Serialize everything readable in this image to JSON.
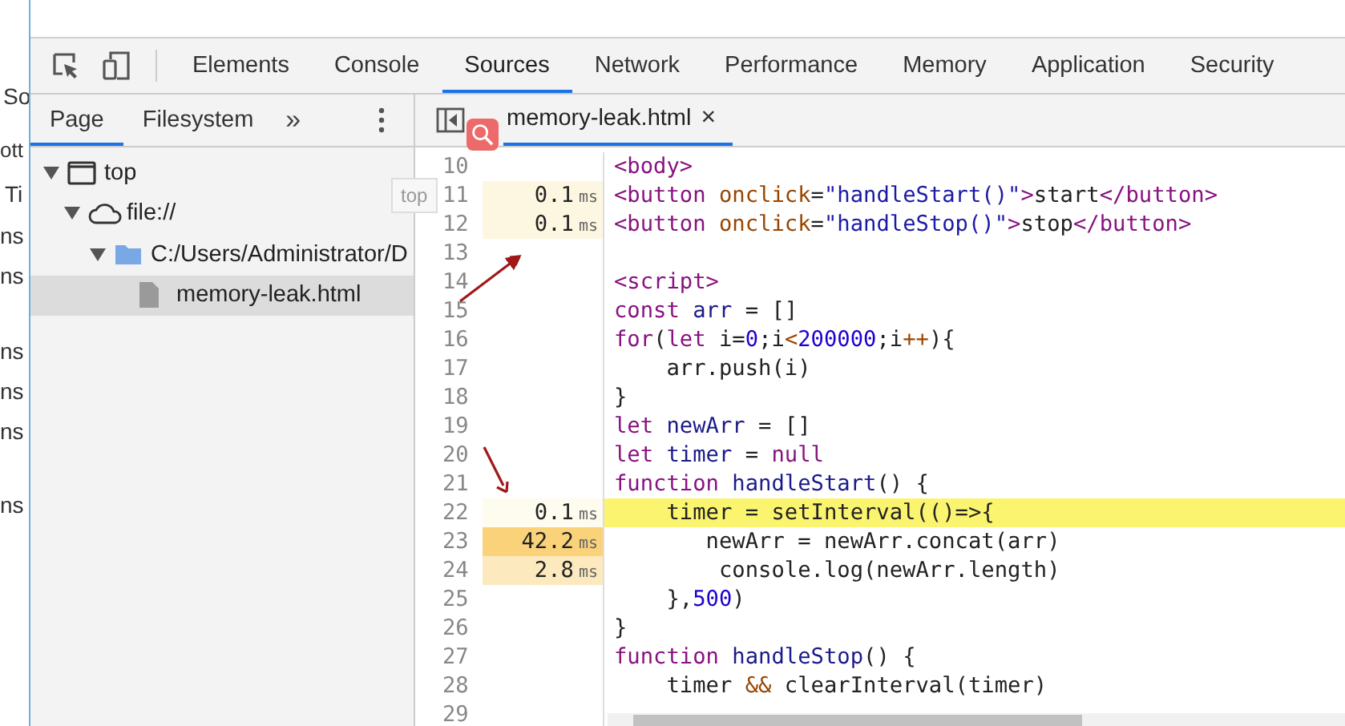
{
  "background_window": {
    "fragments": [
      "So",
      "ott",
      "Ti",
      "ns",
      "ns",
      "ns",
      "ns",
      "ns",
      "ns"
    ]
  },
  "toolbar": {
    "tabs": [
      {
        "label": "Elements",
        "selected": false
      },
      {
        "label": "Console",
        "selected": false
      },
      {
        "label": "Sources",
        "selected": true
      },
      {
        "label": "Network",
        "selected": false
      },
      {
        "label": "Performance",
        "selected": false
      },
      {
        "label": "Memory",
        "selected": false
      },
      {
        "label": "Application",
        "selected": false
      },
      {
        "label": "Security",
        "selected": false
      }
    ]
  },
  "navigator": {
    "tabs": [
      {
        "label": "Page",
        "selected": true
      },
      {
        "label": "Filesystem",
        "selected": false
      }
    ],
    "more": "»",
    "tree": [
      {
        "label": "top",
        "kind": "frame",
        "expanded": true,
        "selected": false,
        "children": [
          {
            "label": "file://",
            "kind": "origin",
            "expanded": true,
            "selected": false,
            "children": [
              {
                "label": "C:/Users/Administrator/D",
                "kind": "folder",
                "expanded": true,
                "selected": false,
                "children": [
                  {
                    "label": "memory-leak.html",
                    "kind": "file",
                    "expanded": false,
                    "selected": true
                  }
                ]
              }
            ]
          }
        ]
      }
    ]
  },
  "editor": {
    "tabs": [
      {
        "label": "memory-leak.html",
        "selected": true,
        "close": "×"
      }
    ],
    "lines": [
      {
        "number": "10",
        "current": false,
        "tokens": [
          {
            "kind": "tag",
            "text": "<body>"
          }
        ]
      },
      {
        "number": "11",
        "current": false,
        "time": "0.1",
        "unit": "ms",
        "color": "#fdf7e2",
        "tokens": [
          {
            "kind": "tag",
            "text": "<button "
          },
          {
            "kind": "attr",
            "text": "onclick"
          },
          {
            "kind": "plain",
            "text": "="
          },
          {
            "kind": "string",
            "text": "\"handleStart()\""
          },
          {
            "kind": "tag",
            "text": ">"
          },
          {
            "kind": "plain",
            "text": "start"
          },
          {
            "kind": "tag",
            "text": "</button>"
          }
        ]
      },
      {
        "number": "12",
        "current": false,
        "time": "0.1",
        "unit": "ms",
        "color": "#fdf7e2",
        "tokens": [
          {
            "kind": "tag",
            "text": "<button "
          },
          {
            "kind": "attr",
            "text": "onclick"
          },
          {
            "kind": "plain",
            "text": "="
          },
          {
            "kind": "string",
            "text": "\"handleStop()\""
          },
          {
            "kind": "tag",
            "text": ">"
          },
          {
            "kind": "plain",
            "text": "stop"
          },
          {
            "kind": "tag",
            "text": "</button>"
          }
        ]
      },
      {
        "number": "13",
        "current": false
      },
      {
        "number": "14",
        "current": false,
        "tokens": [
          {
            "kind": "tag",
            "text": "<script>"
          }
        ]
      },
      {
        "number": "15",
        "current": false,
        "tokens": [
          {
            "kind": "keyword",
            "text": "const"
          },
          {
            "kind": "def",
            "text": " arr"
          },
          {
            "kind": "plain",
            "text": " = []"
          }
        ]
      },
      {
        "number": "16",
        "current": false,
        "tokens": [
          {
            "kind": "keyword",
            "text": "for"
          },
          {
            "kind": "plain",
            "text": "("
          },
          {
            "kind": "keyword",
            "text": "let"
          },
          {
            "kind": "plain",
            "text": " i="
          },
          {
            "kind": "number",
            "text": "0"
          },
          {
            "kind": "plain",
            "text": ";i"
          },
          {
            "kind": "operator",
            "text": "<"
          },
          {
            "kind": "number",
            "text": "200000"
          },
          {
            "kind": "plain",
            "text": ";i"
          },
          {
            "kind": "operator",
            "text": "++"
          },
          {
            "kind": "plain",
            "text": "){"
          }
        ]
      },
      {
        "number": "17",
        "current": false,
        "tokens": [
          {
            "kind": "plain",
            "text": "    arr.push(i)"
          }
        ]
      },
      {
        "number": "18",
        "current": false,
        "tokens": [
          {
            "kind": "plain",
            "text": "}"
          }
        ]
      },
      {
        "number": "19",
        "current": false,
        "tokens": [
          {
            "kind": "keyword",
            "text": "let"
          },
          {
            "kind": "def",
            "text": " newArr"
          },
          {
            "kind": "plain",
            "text": " = []"
          }
        ]
      },
      {
        "number": "20",
        "current": false,
        "tokens": [
          {
            "kind": "keyword",
            "text": "let"
          },
          {
            "kind": "def",
            "text": " timer"
          },
          {
            "kind": "plain",
            "text": " = "
          },
          {
            "kind": "keyword",
            "text": "null"
          }
        ]
      },
      {
        "number": "21",
        "current": false,
        "tokens": [
          {
            "kind": "keyword",
            "text": "function"
          },
          {
            "kind": "def",
            "text": " handleStart"
          },
          {
            "kind": "plain",
            "text": "() {"
          }
        ]
      },
      {
        "number": "22",
        "current": true,
        "time": "0.1",
        "unit": "ms",
        "color": "#fefbef",
        "tokens": [
          {
            "kind": "plain",
            "text": "    timer = setInterval(()=>{"
          }
        ]
      },
      {
        "number": "23",
        "current": false,
        "time": "42.2",
        "unit": "ms",
        "color": "#f9d27a",
        "tokens": [
          {
            "kind": "plain",
            "text": "       newArr = newArr.concat(arr)"
          }
        ]
      },
      {
        "number": "24",
        "current": false,
        "time": "2.8",
        "unit": "ms",
        "color": "#fce9bd",
        "tokens": [
          {
            "kind": "plain",
            "text": "        console.log(newArr.length)"
          }
        ]
      },
      {
        "number": "25",
        "current": false,
        "tokens": [
          {
            "kind": "plain",
            "text": "    },"
          },
          {
            "kind": "number",
            "text": "500"
          },
          {
            "kind": "plain",
            "text": ")"
          }
        ]
      },
      {
        "number": "26",
        "current": false,
        "tokens": [
          {
            "kind": "plain",
            "text": "}"
          }
        ]
      },
      {
        "number": "27",
        "current": false,
        "tokens": [
          {
            "kind": "keyword",
            "text": "function"
          },
          {
            "kind": "def",
            "text": " handleStop"
          },
          {
            "kind": "plain",
            "text": "() {"
          }
        ]
      },
      {
        "number": "28",
        "current": false,
        "tokens": [
          {
            "kind": "plain",
            "text": "    timer "
          },
          {
            "kind": "operator",
            "text": "&&"
          },
          {
            "kind": "plain",
            "text": " clearInterval(timer)"
          }
        ]
      },
      {
        "number": "29",
        "current": false
      }
    ]
  },
  "tooltip": {
    "text": "top"
  }
}
